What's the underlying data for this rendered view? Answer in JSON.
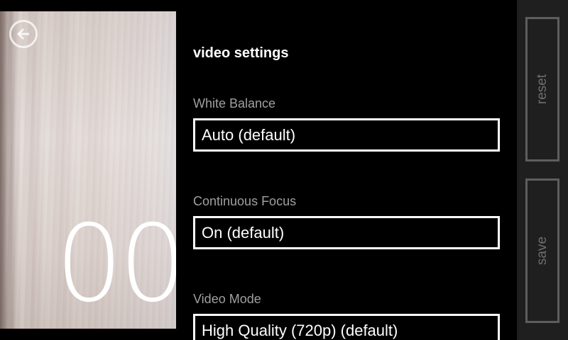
{
  "viewfinder": {
    "timer": "00",
    "back_icon": "back-arrow-icon"
  },
  "settings": {
    "title": "video settings",
    "fields": [
      {
        "label": "White Balance",
        "value": "Auto (default)"
      },
      {
        "label": "Continuous Focus",
        "value": "On (default)"
      },
      {
        "label": "Video Mode",
        "value": "High Quality (720p) (default)"
      }
    ]
  },
  "app_bar": {
    "reset_label": "reset",
    "save_label": "save"
  },
  "colors": {
    "background": "#000000",
    "label_gray": "#a0a0a0",
    "app_bar_bg": "#1f1f1f",
    "app_button_border": "#5e5e5e"
  }
}
